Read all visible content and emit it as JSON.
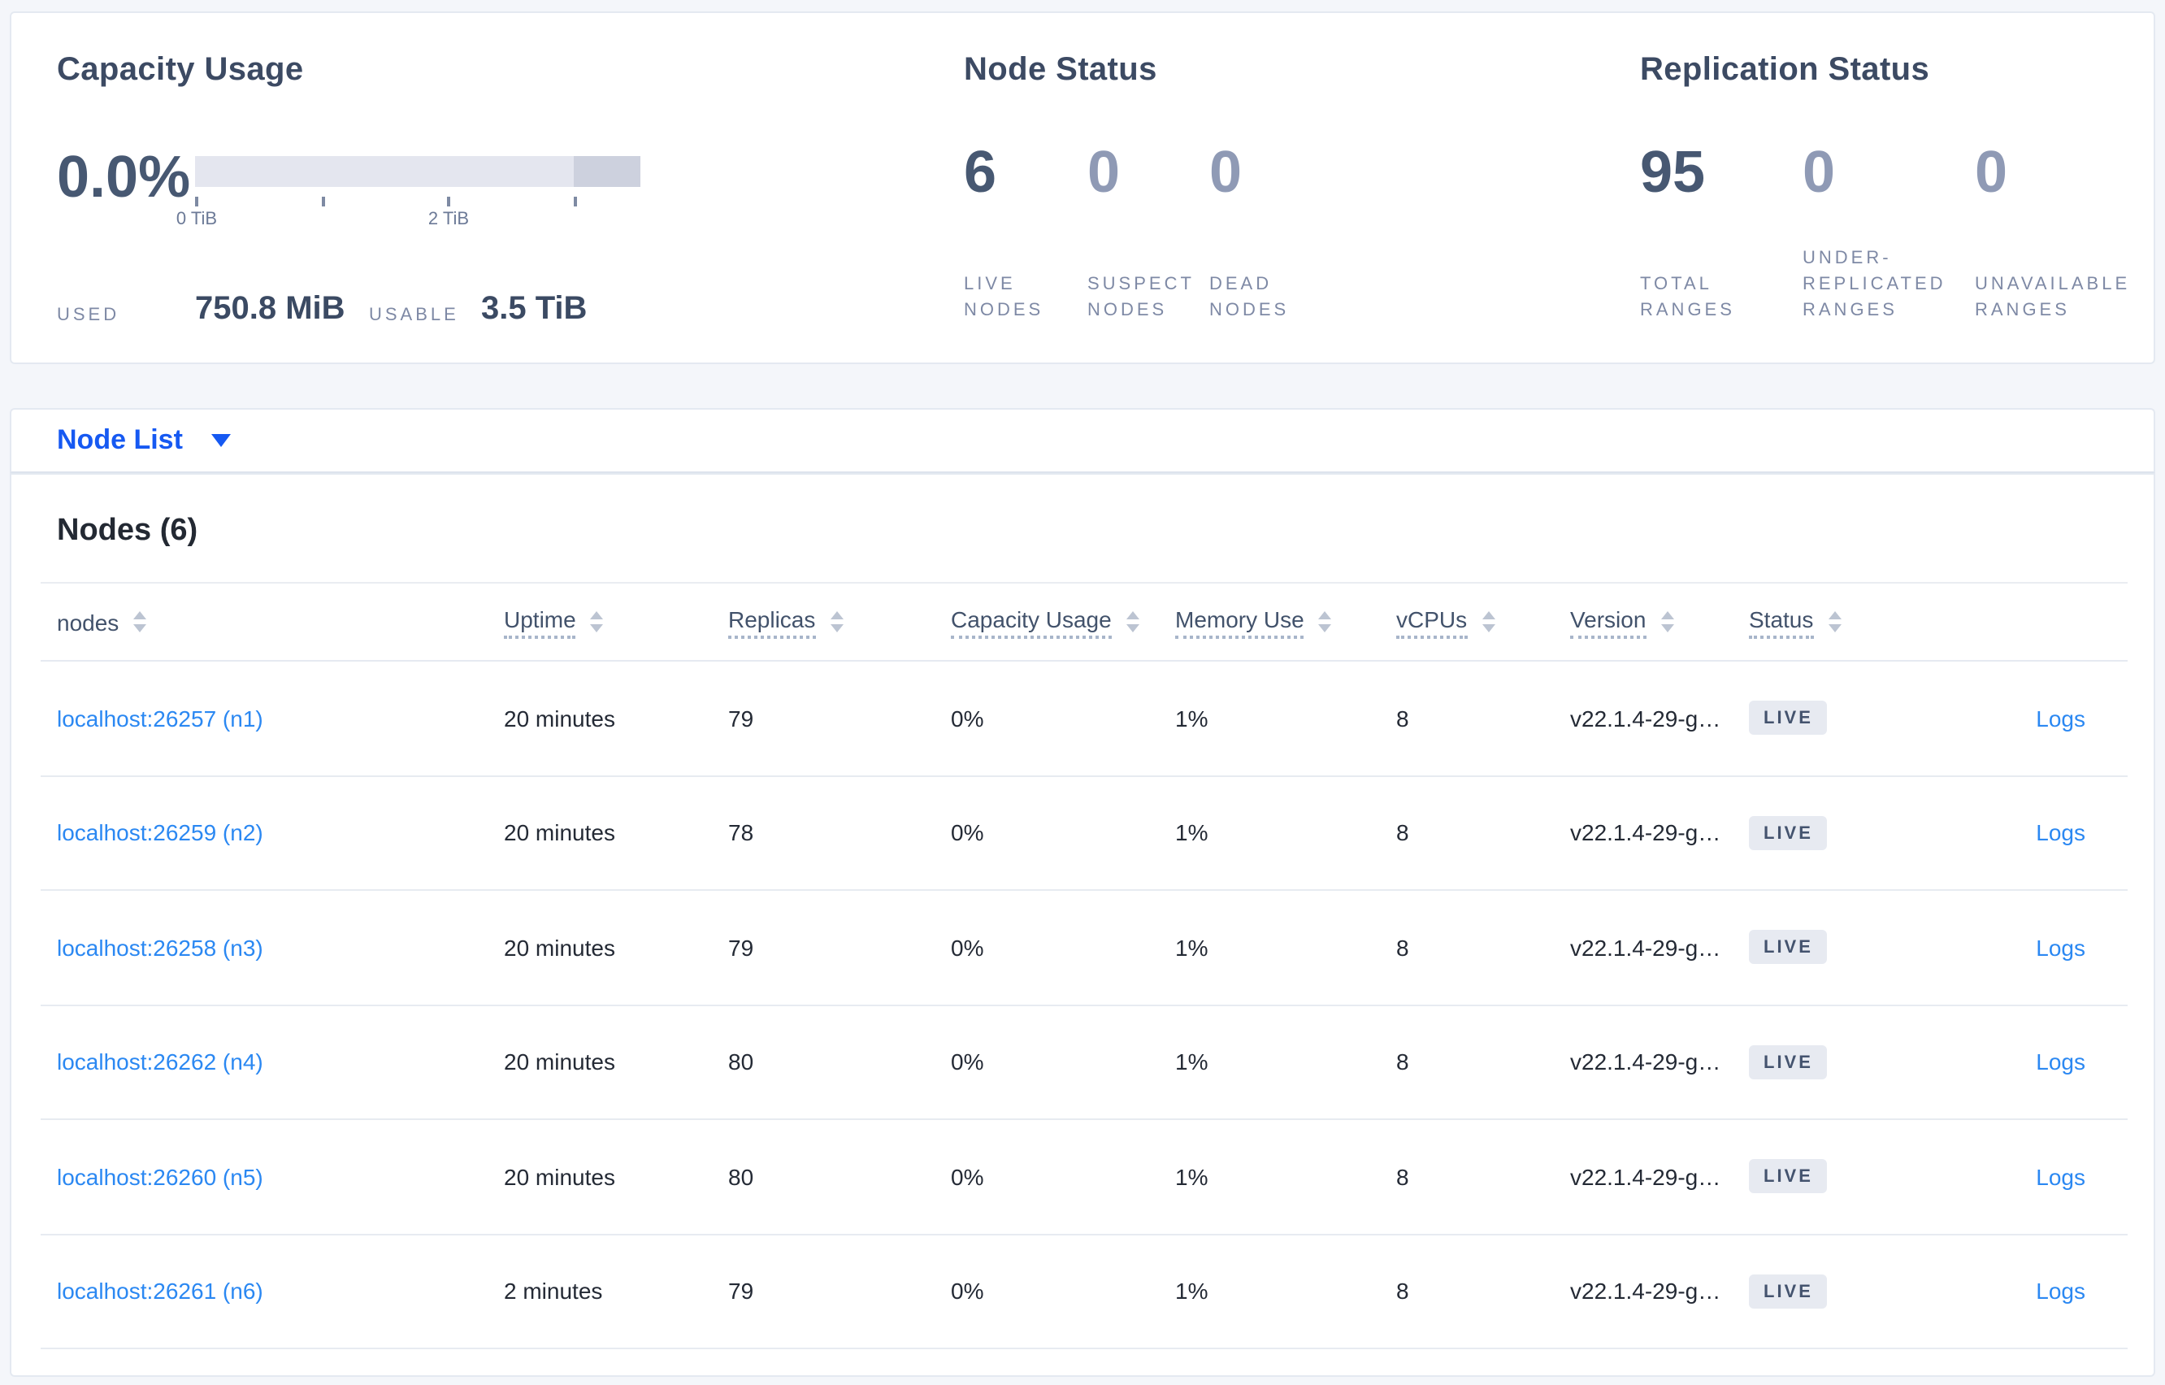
{
  "summary": {
    "capacity": {
      "title": "Capacity Usage",
      "percent": "0.0%",
      "tick_labels": [
        "0 TiB",
        "2 TiB"
      ],
      "used_label": "USED",
      "used_value": "750.8 MiB",
      "usable_label": "USABLE",
      "usable_value": "3.5 TiB",
      "bar": {
        "light_color": "#e4e6ef",
        "dark_color": "#cdd1de",
        "dark_segment_start_pct": 85
      }
    },
    "node_status": {
      "title": "Node Status",
      "stats": [
        {
          "value": "6",
          "label": "LIVE NODES",
          "muted": false
        },
        {
          "value": "0",
          "label": "SUSPECT NODES",
          "muted": true
        },
        {
          "value": "0",
          "label": "DEAD NODES",
          "muted": true
        }
      ]
    },
    "replication": {
      "title": "Replication Status",
      "stats": [
        {
          "value": "95",
          "label": "TOTAL RANGES",
          "muted": false
        },
        {
          "value": "0",
          "label": "UNDER-REPLICATED RANGES",
          "muted": true
        },
        {
          "value": "0",
          "label": "UNAVAILABLE RANGES",
          "muted": true
        }
      ]
    }
  },
  "view_selector": {
    "label": "Node List"
  },
  "nodes_panel": {
    "title": "Nodes (6)",
    "columns": [
      {
        "label": "nodes",
        "tooltip": false
      },
      {
        "label": "Uptime",
        "tooltip": true
      },
      {
        "label": "Replicas",
        "tooltip": true
      },
      {
        "label": "Capacity Usage",
        "tooltip": true
      },
      {
        "label": "Memory Use",
        "tooltip": true
      },
      {
        "label": "vCPUs",
        "tooltip": true
      },
      {
        "label": "Version",
        "tooltip": true
      },
      {
        "label": "Status",
        "tooltip": true
      }
    ],
    "logs_label": "Logs",
    "rows": [
      {
        "node": "localhost:26257 (n1)",
        "uptime": "20 minutes",
        "replicas": "79",
        "capacity_usage": "0%",
        "memory_use": "1%",
        "vcpus": "8",
        "version": "v22.1.4-29-g…",
        "status": "LIVE"
      },
      {
        "node": "localhost:26259 (n2)",
        "uptime": "20 minutes",
        "replicas": "78",
        "capacity_usage": "0%",
        "memory_use": "1%",
        "vcpus": "8",
        "version": "v22.1.4-29-g…",
        "status": "LIVE"
      },
      {
        "node": "localhost:26258 (n3)",
        "uptime": "20 minutes",
        "replicas": "79",
        "capacity_usage": "0%",
        "memory_use": "1%",
        "vcpus": "8",
        "version": "v22.1.4-29-g…",
        "status": "LIVE"
      },
      {
        "node": "localhost:26262 (n4)",
        "uptime": "20 minutes",
        "replicas": "80",
        "capacity_usage": "0%",
        "memory_use": "1%",
        "vcpus": "8",
        "version": "v22.1.4-29-g…",
        "status": "LIVE"
      },
      {
        "node": "localhost:26260 (n5)",
        "uptime": "20 minutes",
        "replicas": "80",
        "capacity_usage": "0%",
        "memory_use": "1%",
        "vcpus": "8",
        "version": "v22.1.4-29-g…",
        "status": "LIVE"
      },
      {
        "node": "localhost:26261 (n6)",
        "uptime": "2 minutes",
        "replicas": "79",
        "capacity_usage": "0%",
        "memory_use": "1%",
        "vcpus": "8",
        "version": "v22.1.4-29-g…",
        "status": "LIVE"
      }
    ]
  }
}
